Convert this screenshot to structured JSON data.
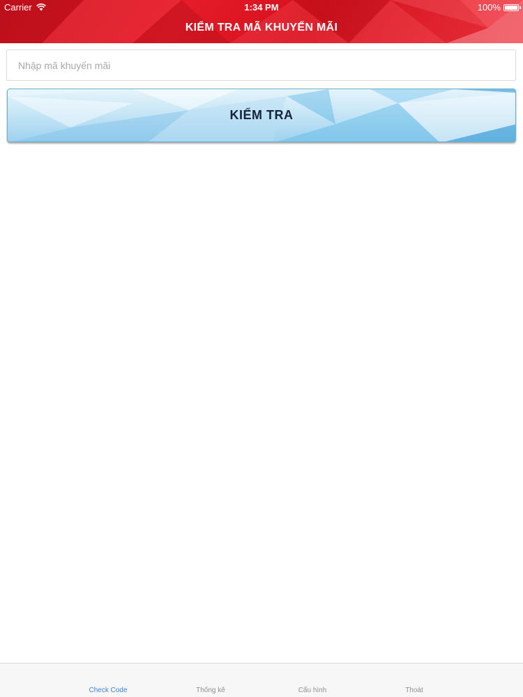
{
  "status_bar": {
    "carrier": "Carrier",
    "time": "1:34 PM",
    "battery": "100%",
    "icons": {
      "wifi": "wifi-icon",
      "battery": "battery-icon"
    }
  },
  "nav": {
    "title": "KIỂM TRA MÃ KHUYẾN MÃI"
  },
  "form": {
    "promo_input": {
      "placeholder": "Nhập mã khuyến mãi",
      "value": ""
    },
    "check_button_label": "KIỂM TRA"
  },
  "tabs": [
    {
      "label": "Check Code",
      "active": true
    },
    {
      "label": "Thống kê",
      "active": false
    },
    {
      "label": "Cấu hình",
      "active": false
    },
    {
      "label": "Thoát",
      "active": false
    }
  ],
  "colors": {
    "header_red": "#e51b28",
    "button_blue": "#9fd2ef",
    "tab_active": "#3b82d6",
    "tab_inactive": "#8e8e93"
  }
}
